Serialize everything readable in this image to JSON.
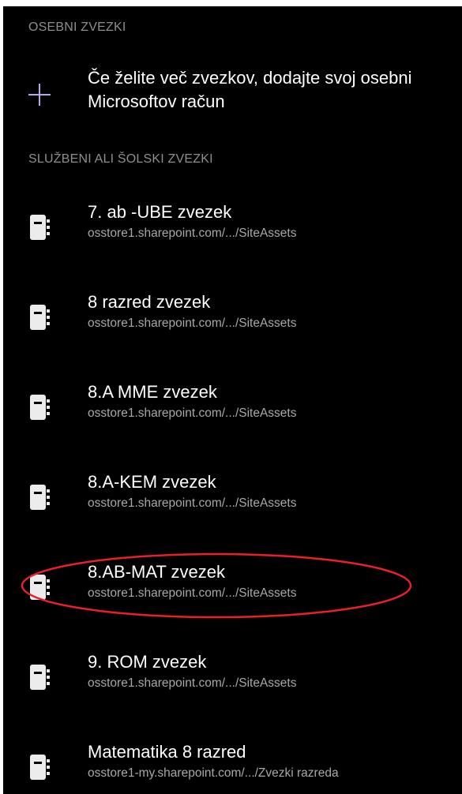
{
  "personal_section": {
    "header": "OSEBNI ZVEZKI",
    "add_account_text": "Če želite več zvezkov, dodajte svoj osebni Microsoftov račun",
    "add_icon": "plus-icon"
  },
  "work_section": {
    "header": "SLUŽBENI ALI ŠOLSKI ZVEZKI",
    "notebooks": [
      {
        "title": "7. ab -UBE zvezek",
        "location": "osstore1.sharepoint.com/.../SiteAssets"
      },
      {
        "title": "8 razred zvezek",
        "location": "osstore1.sharepoint.com/.../SiteAssets"
      },
      {
        "title": "8.A MME zvezek",
        "location": "osstore1.sharepoint.com/.../SiteAssets"
      },
      {
        "title": "8.A-KEM zvezek",
        "location": "osstore1.sharepoint.com/.../SiteAssets"
      },
      {
        "title": "8.AB-MAT zvezek",
        "location": "osstore1.sharepoint.com/.../SiteAssets"
      },
      {
        "title": "9. ROM zvezek",
        "location": "osstore1.sharepoint.com/.../SiteAssets"
      },
      {
        "title": "Matematika 8 razred",
        "location": "osstore1-my.sharepoint.com/.../Zvezki razreda"
      }
    ],
    "notebook_icon": "notebook-icon"
  },
  "colors": {
    "background": "#000000",
    "text_primary": "#ffffff",
    "text_secondary": "#a8a8a8",
    "section_header": "#8e8e8e",
    "accent_plus": "#b9a6ee",
    "annotation_circle": "#e8202a"
  }
}
